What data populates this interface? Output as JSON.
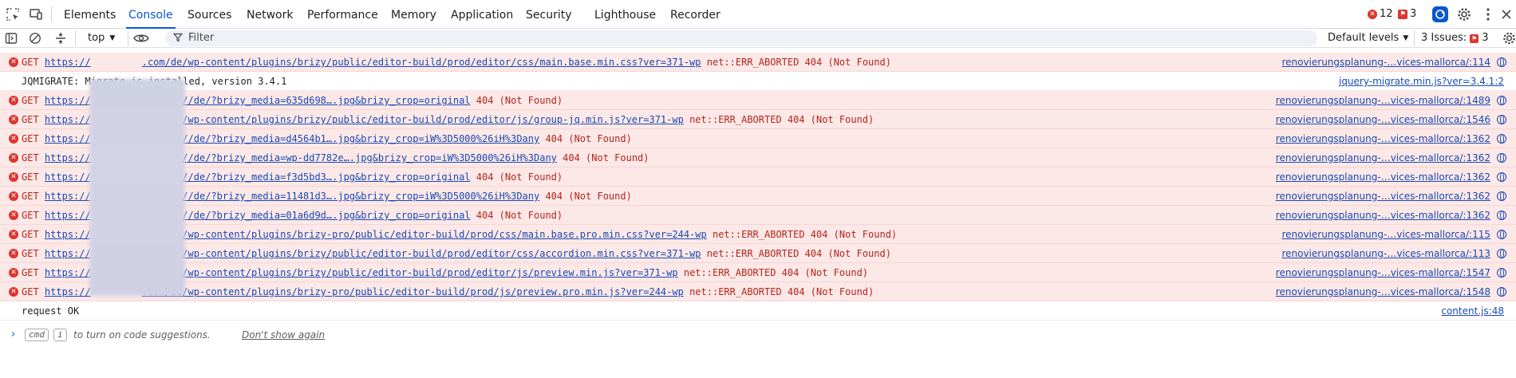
{
  "tabs": [
    "Elements",
    "Console",
    "Sources",
    "Network",
    "Performance",
    "Memory",
    "Application",
    "Security",
    "Lighthouse",
    "Recorder"
  ],
  "active_tab": "Console",
  "counts": {
    "errors": "12",
    "issues_flag": "3"
  },
  "toolbar": {
    "context": "top",
    "filter_placeholder": "Filter",
    "levels": "Default levels",
    "issues_label": "3 Issues:",
    "issues_count": "3"
  },
  "messages": [
    {
      "type": "error",
      "method": "GET",
      "url": "https://",
      "url2": ".com/de/wp-content/plugins/brizy/public/editor-build/prod/editor/css/main.base.min.css?ver=371-wp",
      "tail": "net::ERR_ABORTED 404 (Not Found)",
      "source": "renovierungsplanung-…vices-mallorca/:114"
    },
    {
      "type": "log",
      "text": "JQMIGRATE: Migrate is installed, version 3.4.1",
      "source": "jquery-migrate.min.js?ver=3.4.1:2"
    },
    {
      "type": "error",
      "method": "GET",
      "url": "https://",
      "url2": ".com/de//de/?brizy_media=635d698….jpg&brizy_crop=original",
      "tail": "404 (Not Found)",
      "source": "renovierungsplanung-…vices-mallorca/:1489"
    },
    {
      "type": "error",
      "method": "GET",
      "url": "https://",
      "url2": ".com/de/wp-content/plugins/brizy/public/editor-build/prod/editor/js/group-jq.min.js?ver=371-wp",
      "tail": "net::ERR_ABORTED 404 (Not Found)",
      "source": "renovierungsplanung-…vices-mallorca/:1546"
    },
    {
      "type": "error",
      "method": "GET",
      "url": "https://",
      "url2": ".com/de//de/?brizy_media=d4564b1….jpg&brizy_crop=iW%3D5000%26iH%3Dany",
      "tail": "404 (Not Found)",
      "source": "renovierungsplanung-…vices-mallorca/:1362"
    },
    {
      "type": "error",
      "method": "GET",
      "url": "https://",
      "url2": ".com/de//de/?brizy_media=wp-dd7782e….jpg&brizy_crop=iW%3D5000%26iH%3Dany",
      "tail": "404 (Not Found)",
      "source": "renovierungsplanung-…vices-mallorca/:1362"
    },
    {
      "type": "error",
      "method": "GET",
      "url": "https://",
      "url2": ".com/de//de/?brizy_media=f3d5bd3….jpg&brizy_crop=original",
      "tail": "404 (Not Found)",
      "source": "renovierungsplanung-…vices-mallorca/:1362"
    },
    {
      "type": "error",
      "method": "GET",
      "url": "https://",
      "url2": ".com/de//de/?brizy_media=11481d3….jpg&brizy_crop=iW%3D5000%26iH%3Dany",
      "tail": "404 (Not Found)",
      "source": "renovierungsplanung-…vices-mallorca/:1362"
    },
    {
      "type": "error",
      "method": "GET",
      "url": "https://",
      "url2": ".com/de//de/?brizy_media=01a6d9d….jpg&brizy_crop=original",
      "tail": "404 (Not Found)",
      "source": "renovierungsplanung-…vices-mallorca/:1362"
    },
    {
      "type": "error",
      "method": "GET",
      "url": "https://",
      "url2": ".com/de/wp-content/plugins/brizy-pro/public/editor-build/prod/css/main.base.pro.min.css?ver=244-wp",
      "tail": "net::ERR_ABORTED 404 (Not Found)",
      "source": "renovierungsplanung-…vices-mallorca/:115"
    },
    {
      "type": "error",
      "method": "GET",
      "url": "https://",
      "url2": ".com/de/wp-content/plugins/brizy/public/editor-build/prod/editor/css/accordion.min.css?ver=371-wp",
      "tail": "net::ERR_ABORTED 404 (Not Found)",
      "source": "renovierungsplanung-…vices-mallorca/:113"
    },
    {
      "type": "error",
      "method": "GET",
      "url": "https://",
      "url2": ".com/de/wp-content/plugins/brizy/public/editor-build/prod/editor/js/preview.min.js?ver=371-wp",
      "tail": "net::ERR_ABORTED 404 (Not Found)",
      "source": "renovierungsplanung-…vices-mallorca/:1547"
    },
    {
      "type": "error",
      "method": "GET",
      "url": "https://",
      "url2": ".com/de/wp-content/plugins/brizy-pro/public/editor-build/prod/js/preview.pro.min.js?ver=244-wp",
      "tail": "net::ERR_ABORTED 404 (Not Found)",
      "source": "renovierungsplanung-…vices-mallorca/:1548"
    },
    {
      "type": "log",
      "text": "request OK",
      "source": "content.js:48"
    }
  ],
  "prompt": {
    "key1": "cmd",
    "key2": "i",
    "text": "to turn on code suggestions.",
    "dismiss": "Don't show again"
  }
}
